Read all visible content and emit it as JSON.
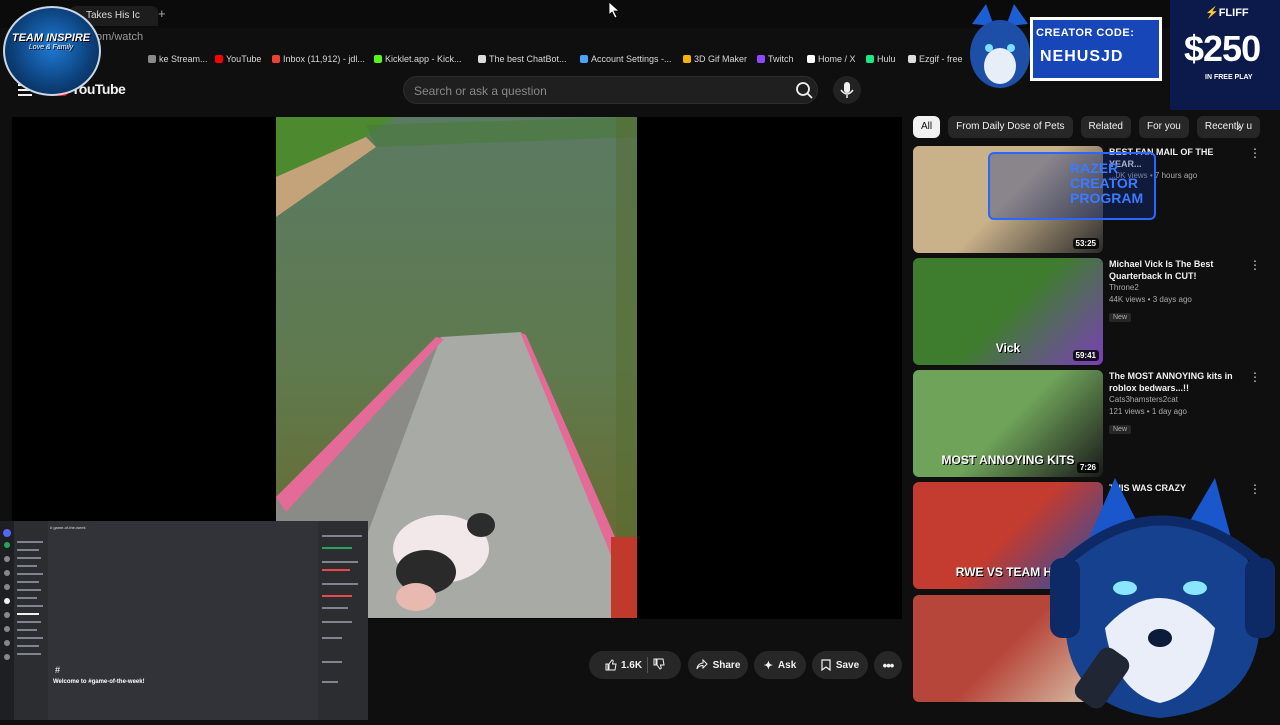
{
  "browser": {
    "tab_title": "Takes His Ic",
    "url_partial": "om/watch",
    "bookmarks": [
      {
        "label": "ke Stream...",
        "color": "#8a8a8a"
      },
      {
        "label": "YouTube",
        "color": "#ff0000"
      },
      {
        "label": "Inbox (11,912) - jdl...",
        "color": "#ea4335"
      },
      {
        "label": "Kicklet.app - Kick...",
        "color": "#53fc18"
      },
      {
        "label": "The best ChatBot...",
        "color": "#dddddd"
      },
      {
        "label": "Account Settings -...",
        "color": "#4aa3ff"
      },
      {
        "label": "3D Gif Maker",
        "color": "#f4b400"
      },
      {
        "label": "Twitch",
        "color": "#9146ff"
      },
      {
        "label": "Home / X",
        "color": "#ffffff"
      },
      {
        "label": "Hulu",
        "color": "#1ce783"
      },
      {
        "label": "Ezgif - free",
        "color": "#dddddd"
      }
    ]
  },
  "youtube": {
    "logo_text": "YouTube",
    "search_placeholder": "Search or ask a question"
  },
  "actions": {
    "like_count": "1.6K",
    "share_label": "Share",
    "ask_label": "Ask",
    "save_label": "Save"
  },
  "chips": [
    "All",
    "From Daily Dose of Pets",
    "Related",
    "For you",
    "Recently u"
  ],
  "recommendations": [
    {
      "title": "BEST FAN MAIL OF THE YEAR...",
      "channel": "",
      "meta": "...0K views • 7 hours ago",
      "duration": "53:25",
      "new": false,
      "thumb_colors": [
        "#c9b18a",
        "#2b2b2b"
      ]
    },
    {
      "title": "Michael Vick Is The Best Quarterback In CUT!",
      "channel": "Throne2",
      "meta": "44K views • 3 days ago",
      "duration": "59:41",
      "new": true,
      "thumb_text": "Vick",
      "thumb_colors": [
        "#3f7d2e",
        "#7b3fb8"
      ]
    },
    {
      "title": "The MOST ANNOYING kits in roblox bedwars...!!",
      "channel": "Cats3hamsters2cat",
      "meta": "121 views • 1 day ago",
      "duration": "7:26",
      "new": true,
      "thumb_text": "MOST ANNOYING KITS",
      "thumb_colors": [
        "#6fa35a",
        "#1a1a1a"
      ]
    },
    {
      "title": "THIS WAS CRAZY",
      "channel": "",
      "meta": "",
      "duration": "",
      "new": false,
      "thumb_text": "RWE VS TEAM HE",
      "thumb_colors": [
        "#c43b2f",
        "#1d4fb0"
      ]
    },
    {
      "title": "",
      "channel": "",
      "meta": "",
      "duration": "",
      "new": false,
      "thumb_colors": [
        "#b7463a",
        "#d9c7b0"
      ]
    }
  ],
  "discord": {
    "welcome": "Welcome to #game-of-the-week!",
    "hash": "#",
    "channel_header": "# game-of-the-week"
  },
  "overlays": {
    "team_logo": "TEAM INSPIRE",
    "team_sub": "Love & Family",
    "creator_label": "CREATOR CODE:",
    "creator_code": "NEHUSJD",
    "fliff_brand": "⚡FLIFF",
    "fliff_amount": "$250",
    "fliff_sub": "IN FREE PLAY",
    "razer_text": [
      "RAZER",
      "CREATOR",
      "PROGRAM"
    ]
  }
}
